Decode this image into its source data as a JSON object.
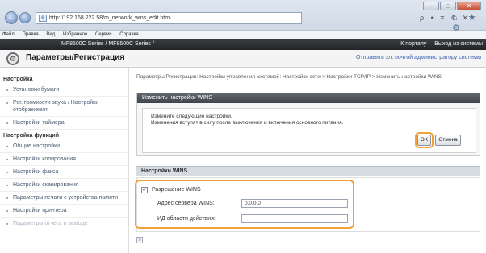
{
  "browser": {
    "window_buttons": [
      "–",
      "□",
      "✕"
    ],
    "address": "http://192.168.222.58/m_network_wins_edit.html",
    "address_tools": "ρ • ≡ ¢ ✕",
    "right_icons": "⌂ ★ ⚙",
    "back_glyph": "←",
    "forward_glyph": "→",
    "menu": [
      "Файл",
      "Правка",
      "Вид",
      "Избранное",
      "Сервис",
      "Справка"
    ]
  },
  "device_bar": {
    "model": "MF8500C Series / MF8500C Series /",
    "links": [
      "К порталу",
      "Выход из системы"
    ]
  },
  "header": {
    "title": "Параметры/Регистрация",
    "admin_link": "Отправить эл. почтой администратору системы"
  },
  "sidebar": {
    "sections": [
      {
        "title": "Настройка",
        "items": [
          "Установки бумаги",
          "Рег. громкости звука / Настройки отображения",
          "Настройки таймера"
        ]
      },
      {
        "title": "Настройка функций",
        "items": [
          "Общие настройки",
          "Настройки копирования",
          "Настройки факса",
          "Настройки сканирования",
          "Параметры печати с устройства памяти",
          "Настройки принтера",
          "Параметры отчета о выводе"
        ]
      }
    ]
  },
  "main": {
    "breadcrumb": "Параметры/Регистрация: Настройки управления системой: Настройки сети > Настройки TCP/IP > Изменить настройки WINS",
    "panel_title": "Изменить настройки WINS",
    "note_line1": "Измените следующие настройки.",
    "note_line2": "Изменения вступят в силу после выключения и включения основного питания.",
    "ok_label": "OK",
    "cancel_label": "Отмена",
    "wins_section_title": "Настройки WINS",
    "wins_resolution_label": "Разрешение WINS",
    "wins_resolution_checked": true,
    "wins_server_label": "Адрес сервера WINS:",
    "wins_server_value": "0.0.0.0",
    "scope_id_label": "ИД области действия:",
    "scope_id_value": ""
  }
}
